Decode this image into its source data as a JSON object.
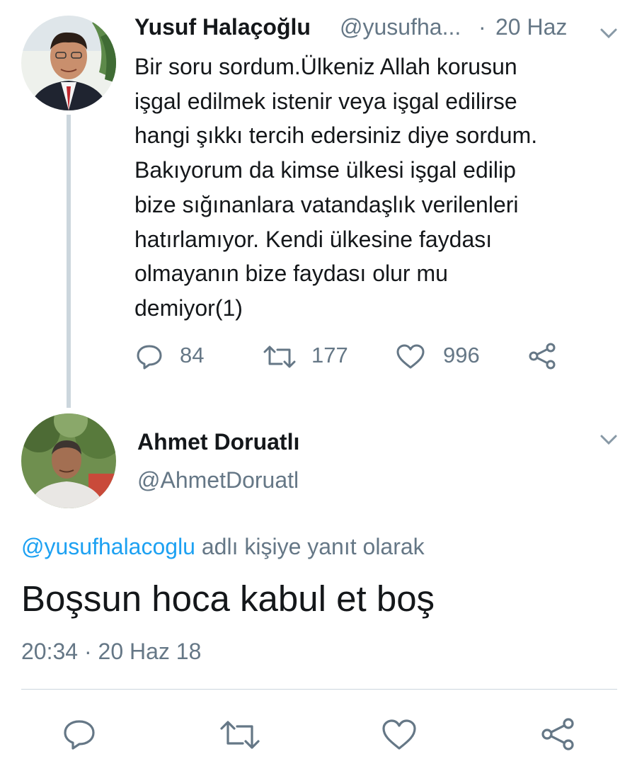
{
  "tweet1": {
    "author_name": "Yusuf Halaçoğlu",
    "handle": "@yusufha...",
    "separator": "·",
    "date": "20 Haz",
    "text_lines": [
      "Bir soru sordum.Ülkeniz Allah korusun",
      "işgal edilmek istenir veya işgal edilirse",
      "hangi şıkkı tercih edersiniz diye sordum.",
      "Bakıyorum da kimse ülkesi işgal edilip",
      "bize sığınanlara vatandaşlık verilenleri",
      "hatırlamıyor. Kendi ülkesine faydası",
      "olmayanın bize faydası olur mu",
      "demiyor(1)"
    ],
    "actions": {
      "reply_icon": "speech-bubble-icon",
      "reply_count": "84",
      "retweet_icon": "retweet-icon",
      "retweet_count": "177",
      "like_icon": "heart-icon",
      "like_count": "996",
      "share_icon": "share-icon"
    }
  },
  "tweet2": {
    "author_name": "Ahmet Doruatlı",
    "handle": "@AhmetDoruatl",
    "reply_context_mention": "@yusufhalacoglu",
    "reply_context_text": " adlı kişiye yanıt olarak",
    "text": "Boşsun hoca kabul et boş",
    "timestamp": "20:34 · 20 Haz 18",
    "actions": {
      "reply_icon": "speech-bubble-icon",
      "retweet_icon": "retweet-icon",
      "like_icon": "heart-icon",
      "share_icon": "share-icon"
    }
  },
  "colors": {
    "text_primary": "#14171a",
    "text_secondary": "#657786",
    "link": "#1da1f2",
    "divider": "#ccd6dd"
  }
}
